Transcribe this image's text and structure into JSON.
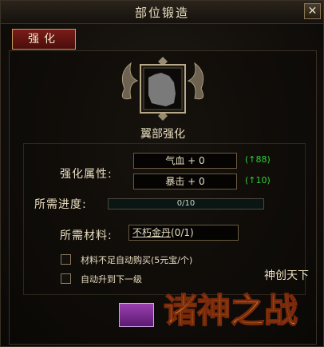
{
  "window": {
    "title": "部位锻造",
    "close_symbol": "✕"
  },
  "tabs": [
    {
      "label": "强化"
    }
  ],
  "part": {
    "name": "翼部强化",
    "icon": "wing-silhouette-icon"
  },
  "enhance": {
    "label": "强化属性:",
    "attributes": [
      {
        "text": "气血 + 0",
        "bonus": "(↑88)"
      },
      {
        "text": "暴击 + 0",
        "bonus": "(↑10)"
      }
    ]
  },
  "progress": {
    "label": "所需进度:",
    "text": "0/10",
    "value": 0
  },
  "material": {
    "label": "所需材料:",
    "name": "不朽金丹",
    "count": "(0/1)"
  },
  "options": [
    {
      "label": "材料不足自动购买(5元宝/个)",
      "checked": false
    },
    {
      "label": "自动升到下一级",
      "checked": false
    }
  ],
  "logo": {
    "main": "诸神之战",
    "sub": "神创天下"
  },
  "colors": {
    "accent_green": "#2ecf3a",
    "tab_red": "#7a1c18",
    "text": "#e8dcc0"
  }
}
